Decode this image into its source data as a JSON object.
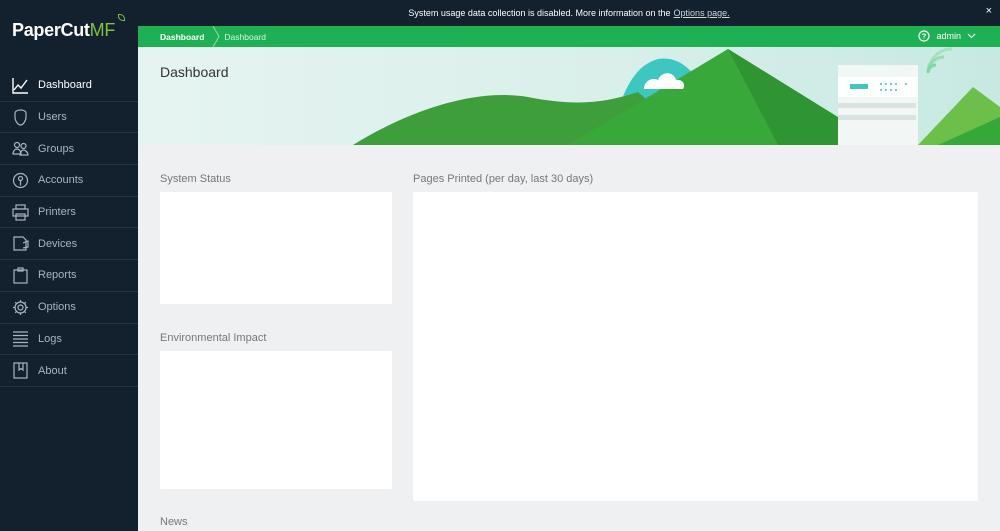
{
  "brand": {
    "name_main": "PaperCut",
    "name_suffix": "MF"
  },
  "sidebar": {
    "items": [
      {
        "label": "Dashboard",
        "icon": "dashboard-chart-icon",
        "active": true
      },
      {
        "label": "Users",
        "icon": "user-icon",
        "active": false
      },
      {
        "label": "Groups",
        "icon": "group-icon",
        "active": false
      },
      {
        "label": "Accounts",
        "icon": "accounts-icon",
        "active": false
      },
      {
        "label": "Printers",
        "icon": "printer-icon",
        "active": false
      },
      {
        "label": "Devices",
        "icon": "device-icon",
        "active": false
      },
      {
        "label": "Reports",
        "icon": "clipboard-icon",
        "active": false
      },
      {
        "label": "Options",
        "icon": "gear-icon",
        "active": false
      },
      {
        "label": "Logs",
        "icon": "lines-icon",
        "active": false
      },
      {
        "label": "About",
        "icon": "book-icon",
        "active": false
      }
    ]
  },
  "notice": {
    "text": "System usage data collection is disabled. More information on the",
    "link": "Options page.",
    "close": "×"
  },
  "breadcrumb": {
    "root": "Dashboard",
    "current": "Dashboard"
  },
  "user": {
    "name": "admin"
  },
  "banner": {
    "title": "Dashboard"
  },
  "sections": {
    "system_status": "System Status",
    "environmental_impact": "Environmental Impact",
    "news": "News",
    "pages_printed": "Pages Printed (per day, last 30 days)"
  },
  "colors": {
    "sidebar_bg": "#13202e",
    "accent_green": "#1eb154",
    "logo_green": "#7fc241"
  }
}
